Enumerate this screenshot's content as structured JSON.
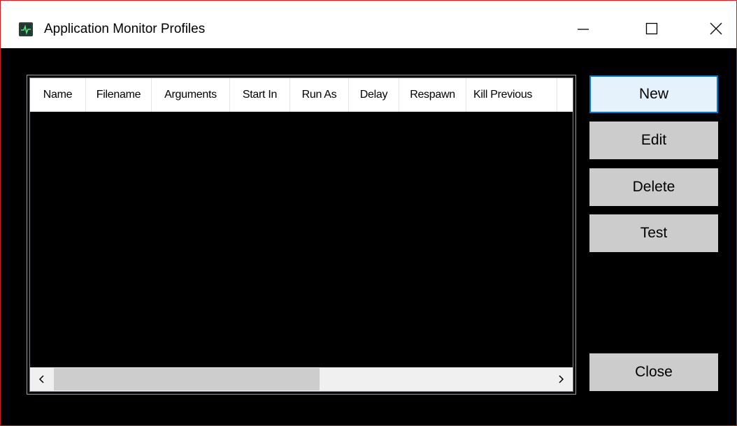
{
  "window": {
    "title": "Application Monitor Profiles",
    "app_icon": "app-monitor-icon",
    "controls": {
      "minimize_icon": "minimize-icon",
      "maximize_icon": "maximize-icon",
      "close_icon": "close-icon"
    }
  },
  "list": {
    "columns": [
      "Name",
      "Filename",
      "Arguments",
      "Start In",
      "Run As",
      "Delay",
      "Respawn",
      "Kill Previous"
    ],
    "rows": [],
    "scrollbar": {
      "left_icon": "chevron-left-icon",
      "right_icon": "chevron-right-icon"
    }
  },
  "buttons": {
    "new": "New",
    "edit": "Edit",
    "delete": "Delete",
    "test": "Test",
    "close": "Close"
  },
  "colors": {
    "background": "#000000",
    "button_face": "#cccccc",
    "default_button_border": "#0078d7",
    "default_button_face": "#e5f1fb",
    "window_border": "#b22a2a"
  }
}
